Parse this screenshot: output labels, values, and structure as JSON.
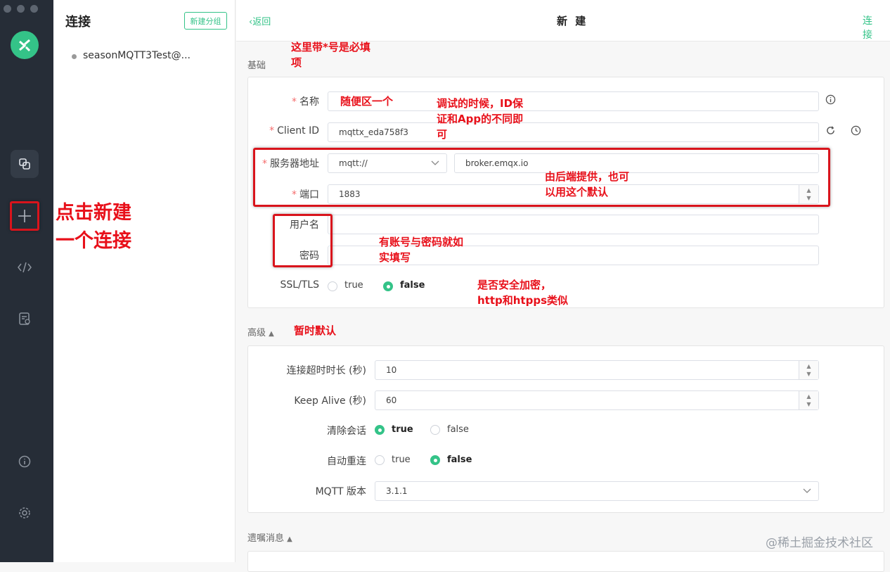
{
  "sidebar": {
    "icons": [
      "copy-icon",
      "plus-icon",
      "code-icon",
      "log-icon",
      "info-icon",
      "gear-icon"
    ]
  },
  "list": {
    "title": "连接",
    "new_group_label": "新建分组",
    "connections": [
      {
        "name": "seasonMQTT3Test@..."
      }
    ]
  },
  "header": {
    "back_label": "返回",
    "title": "新 建",
    "connect_label": "连 接"
  },
  "basic": {
    "section_label": "基础",
    "name_label": "名称",
    "name_value": "",
    "client_id_label": "Client ID",
    "client_id_value": "mqttx_eda758f3",
    "host_label": "服务器地址",
    "protocol_value": "mqtt://",
    "host_value": "broker.emqx.io",
    "port_label": "端口",
    "port_value": "1883",
    "username_label": "用户名",
    "username_value": "",
    "password_label": "密码",
    "password_value": "",
    "ssl_label": "SSL/TLS",
    "ssl_true": "true",
    "ssl_false": "false",
    "ssl_selected": "false"
  },
  "advanced": {
    "section_label": "高级",
    "timeout_label": "连接超时时长 (秒)",
    "timeout_value": "10",
    "keepalive_label": "Keep Alive (秒)",
    "keepalive_value": "60",
    "clean_label": "清除会话",
    "clean_true": "true",
    "clean_false": "false",
    "clean_selected": "true",
    "reconnect_label": "自动重连",
    "reconnect_true": "true",
    "reconnect_false": "false",
    "reconnect_selected": "false",
    "version_label": "MQTT 版本",
    "version_value": "3.1.1"
  },
  "will": {
    "section_label": "遗嘱消息"
  },
  "annotations": {
    "required_note_1": "这里带*号是必填",
    "required_note_2": "项",
    "name_note": "随便区一个",
    "clientid_note_1": "调试的时候，ID保",
    "clientid_note_2": "证和App的不同即",
    "clientid_note_3": "可",
    "server_note_1": "由后端提供，也可",
    "server_note_2": "以用这个默认",
    "account_note_1": "有账号与密码就如",
    "account_note_2": "实填写",
    "ssl_note_1": "是否安全加密，",
    "ssl_note_2": "http和htpps类似",
    "advanced_note": "暂时默认",
    "new_conn_note_1": "点击新建",
    "new_conn_note_2": "一个连接"
  },
  "watermark": "@稀土掘金技术社区",
  "colors": {
    "accent": "#34c388",
    "sidebar_bg": "#262d37",
    "annotation_red": "#e8101a"
  }
}
